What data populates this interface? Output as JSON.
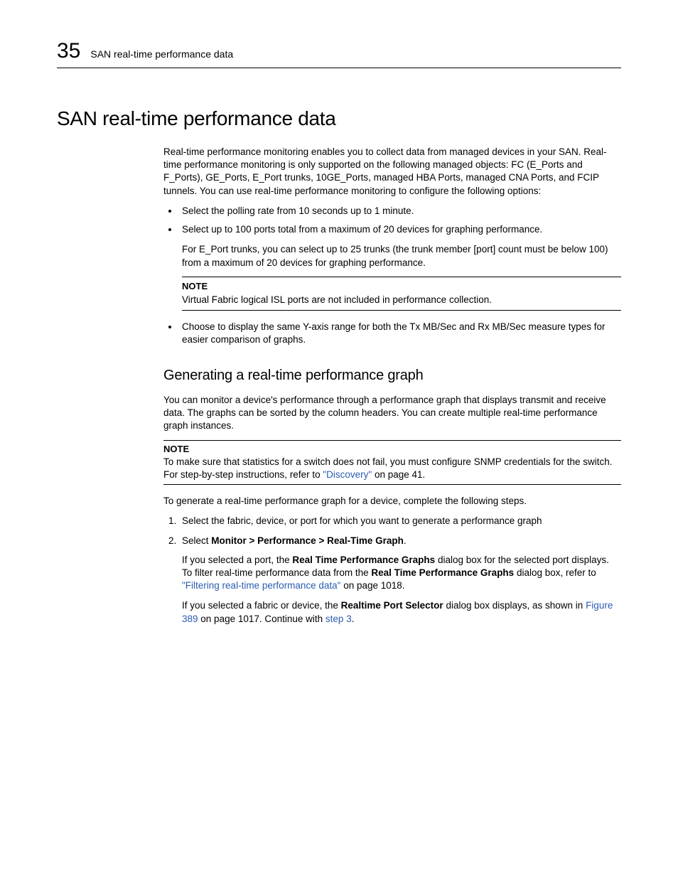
{
  "header": {
    "chapter_number": "35",
    "running_title": "SAN real-time performance data"
  },
  "h1": "SAN real-time performance data",
  "intro": "Real-time performance monitoring enables you to collect data from managed devices in your SAN. Real-time performance monitoring is only supported on the following managed objects: FC (E_Ports and F_Ports), GE_Ports, E_Port trunks, 10GE_Ports, managed HBA Ports, managed CNA Ports, and FCIP tunnels. You can use real-time performance monitoring to configure the following options:",
  "bullets": {
    "b1": "Select the polling rate from 10 seconds up to 1 minute.",
    "b2": "Select up to 100 ports total from a maximum of 20 devices for graphing performance.",
    "b2_sub": "For E_Port trunks, you can select up to 25 trunks (the trunk member [port] count must be below 100) from a maximum of 20 devices for graphing performance.",
    "b3": "Choose to display the same Y-axis range for both the Tx MB/Sec and Rx MB/Sec measure types for easier comparison of graphs."
  },
  "note1": {
    "label": "NOTE",
    "body": "Virtual Fabric logical ISL ports are not included in performance collection."
  },
  "h2": "Generating a real-time performance graph",
  "p2": "You can monitor a device's performance through a performance graph that displays transmit and receive data. The graphs can be sorted by the column headers. You can create multiple real-time performance graph instances.",
  "note2": {
    "label": "NOTE",
    "body_pre": "To make sure that statistics for a switch does not fail, you must configure SNMP credentials for the switch. For step-by-step instructions, refer to ",
    "link": "\"Discovery\"",
    "body_post": " on page 41."
  },
  "p3": "To generate a real-time performance graph for a device, complete the following steps.",
  "steps": {
    "s1": "Select the fabric, device, or port for which you want to generate a performance graph",
    "s2_pre": "Select ",
    "s2_bold": "Monitor > Performance > Real-Time Graph",
    "s2_post": ".",
    "s2_sub1_pre": "If you selected a port, the ",
    "s2_sub1_bold1": "Real Time Performance Graphs",
    "s2_sub1_mid": " dialog box for the selected port displays. To filter real-time performance data from the ",
    "s2_sub1_bold2": "Real Time Performance Graphs",
    "s2_sub1_post": " dialog box, refer to ",
    "s2_sub1_link": "\"Filtering real-time performance data\"",
    "s2_sub1_end": " on page 1018.",
    "s2_sub2_pre": "If you selected a fabric or device, the ",
    "s2_sub2_bold": "Realtime Port Selector",
    "s2_sub2_mid": " dialog box displays, as shown in ",
    "s2_sub2_link1": "Figure 389",
    "s2_sub2_mid2": " on page 1017. Continue with ",
    "s2_sub2_link2": "step 3",
    "s2_sub2_end": "."
  }
}
